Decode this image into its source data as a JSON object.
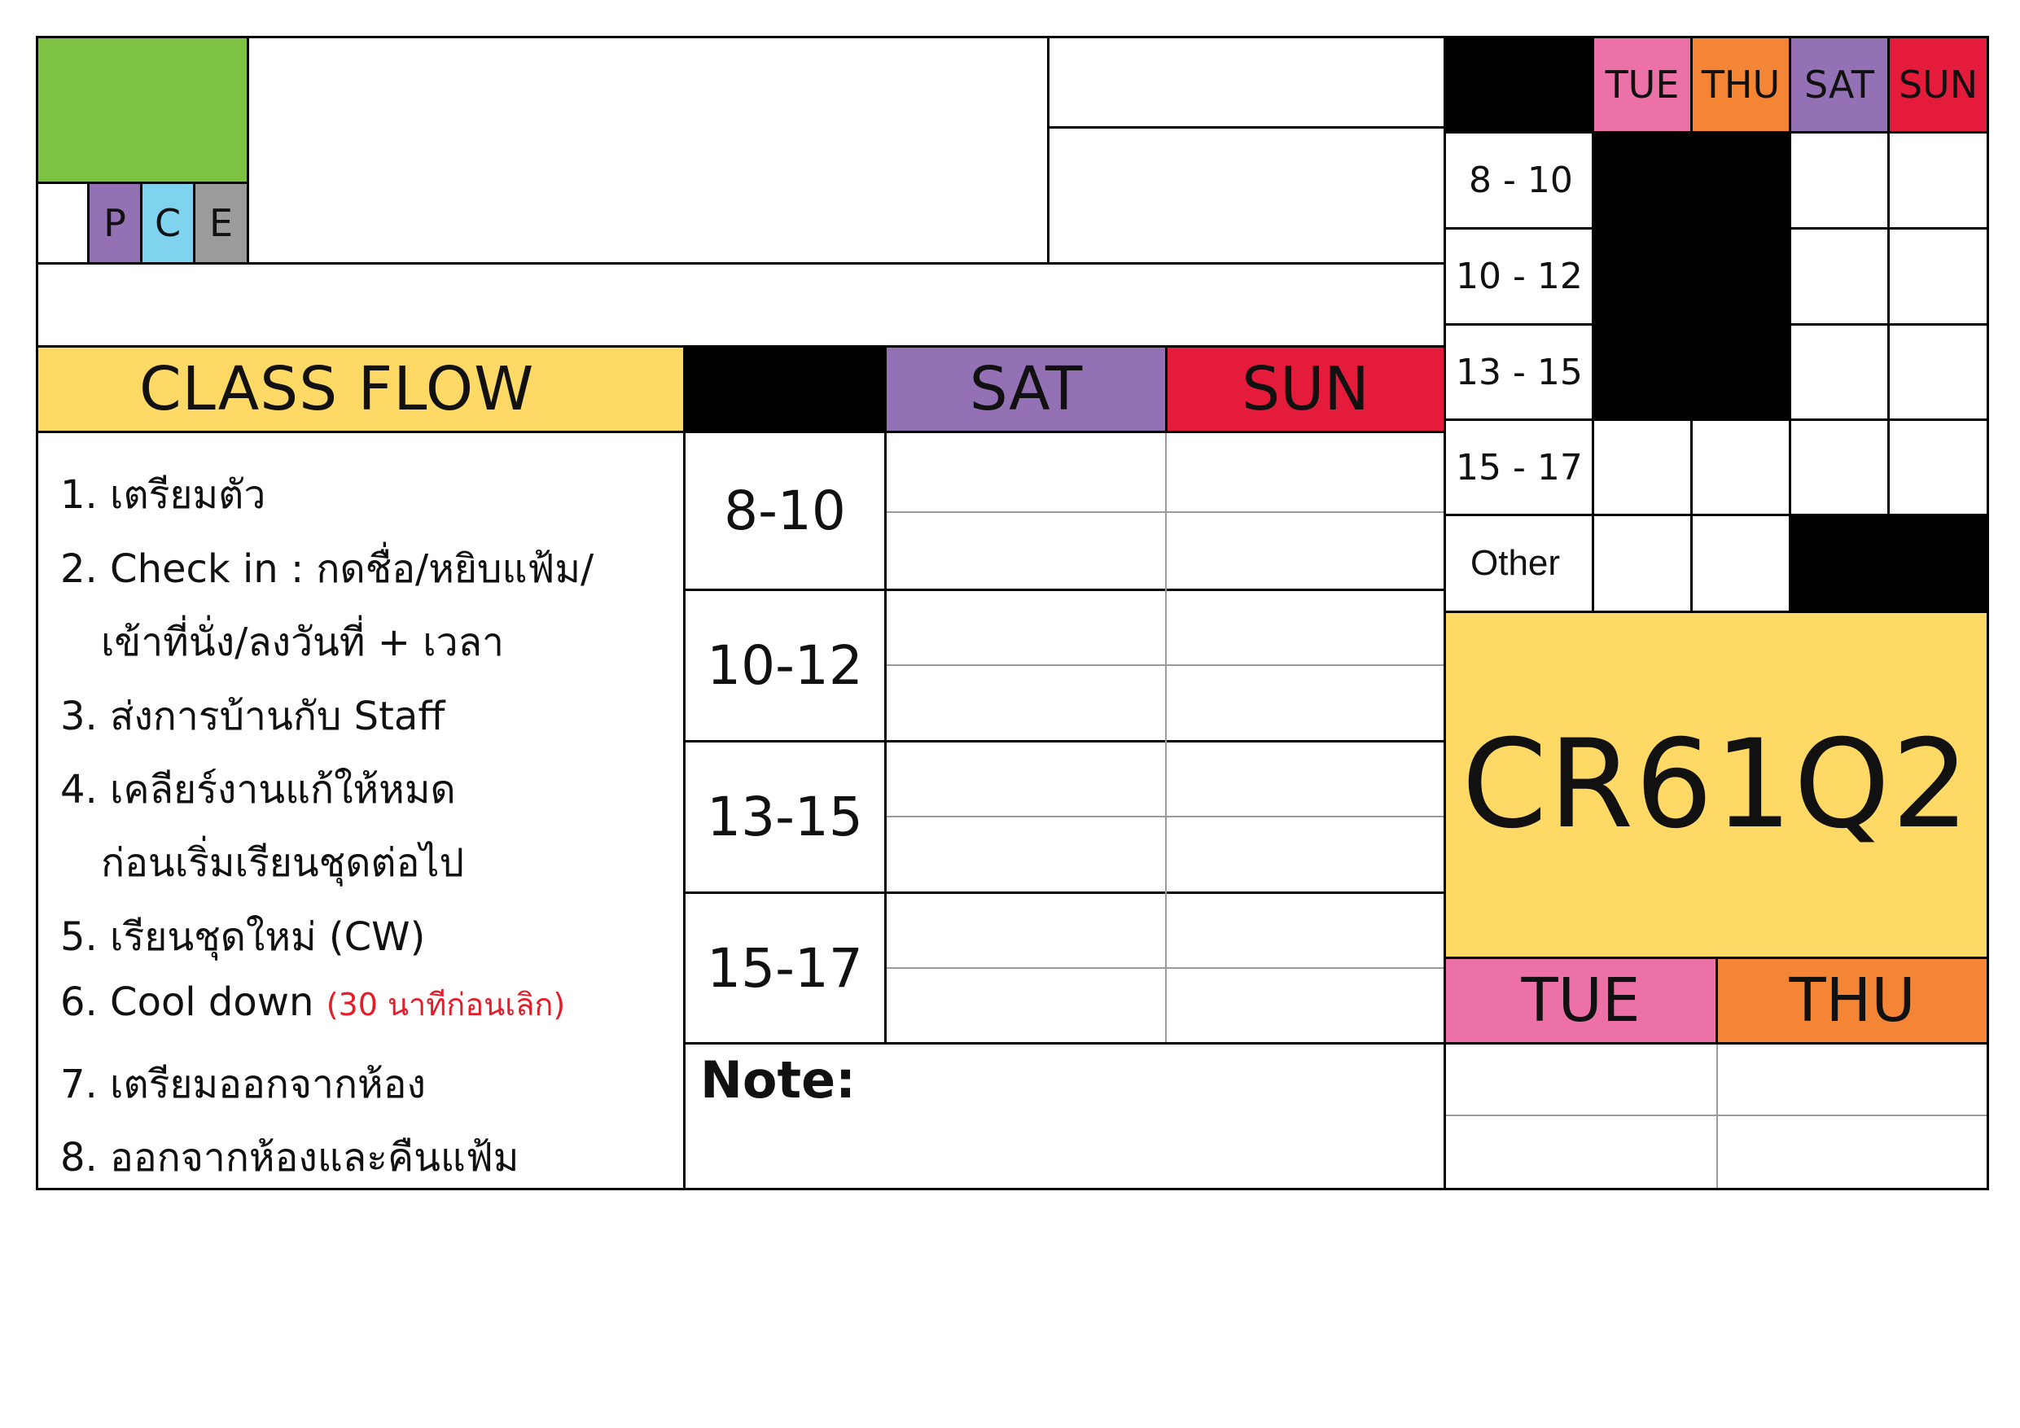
{
  "colors": {
    "green": "#7dc242",
    "purple": "#9471b4",
    "cyan": "#7fd3ef",
    "gray": "#9b9b9b",
    "yellow": "#fed966",
    "pink": "#ec71a6",
    "orange": "#f48534",
    "red": "#e51b3b",
    "note_red": "#e31e2a"
  },
  "pce": {
    "p": "P",
    "c": "C",
    "e": "E"
  },
  "class_flow": {
    "title": "CLASS FLOW",
    "items": [
      {
        "text": "1. เตรียมตัว"
      },
      {
        "text": "2. Check in : กดชื่อ/หยิบแฟ้ม/"
      },
      {
        "text": "เข้าที่นั่ง/ลงวันที่ + เวลา"
      },
      {
        "text": "3. ส่งการบ้านกับ Staff"
      },
      {
        "text": "4. เคลียร์งานแก้ให้หมด"
      },
      {
        "text": "ก่อนเริ่มเรียนชุดต่อไป"
      },
      {
        "text": "5. เรียนชุดใหม่ (CW)"
      },
      {
        "text": "6. Cool down",
        "note": "(30 นาทีก่อนเลิก)"
      },
      {
        "text": "7. เตรียมออกจากห้อง"
      },
      {
        "text": "8. ออกจากห้องและคืนแฟ้ม"
      }
    ]
  },
  "weekend_schedule": {
    "days": [
      "SAT",
      "SUN"
    ],
    "slots": [
      "8-10",
      "10-12",
      "13-15",
      "15-17"
    ],
    "note_label": "Note:"
  },
  "week_grid": {
    "days": [
      "TUE",
      "THU",
      "SAT",
      "SUN"
    ],
    "slots": [
      "8 - 10",
      "10 - 12",
      "13 - 15",
      "15 - 17",
      "Other"
    ]
  },
  "class_code": "CR61Q2",
  "weekday_schedule": {
    "days": [
      "TUE",
      "THU"
    ]
  }
}
